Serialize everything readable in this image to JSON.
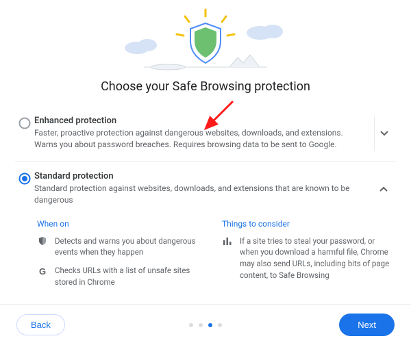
{
  "title": "Choose your Safe Browsing protection",
  "options": {
    "enhanced": {
      "title": "Enhanced protection",
      "desc": "Faster, proactive protection against dangerous websites, downloads, and extensions. Warns you about password breaches. Requires browsing data to be sent to Google.",
      "selected": false,
      "expanded": false
    },
    "standard": {
      "title": "Standard protection",
      "desc": "Standard protection against websites, downloads, and extensions that are known to be dangerous",
      "selected": true,
      "expanded": true
    }
  },
  "details": {
    "when_on": {
      "heading": "When on",
      "items": [
        "Detects and warns you about dangerous events when they happen",
        "Checks URLs with a list of unsafe sites stored in Chrome"
      ]
    },
    "consider": {
      "heading": "Things to consider",
      "items": [
        "If a site tries to steal your password, or when you download a harmful file, Chrome may also send URLs, including bits of page content, to Safe Browsing"
      ]
    }
  },
  "footer": {
    "back": "Back",
    "next": "Next",
    "step_index": 2,
    "step_count": 4
  }
}
